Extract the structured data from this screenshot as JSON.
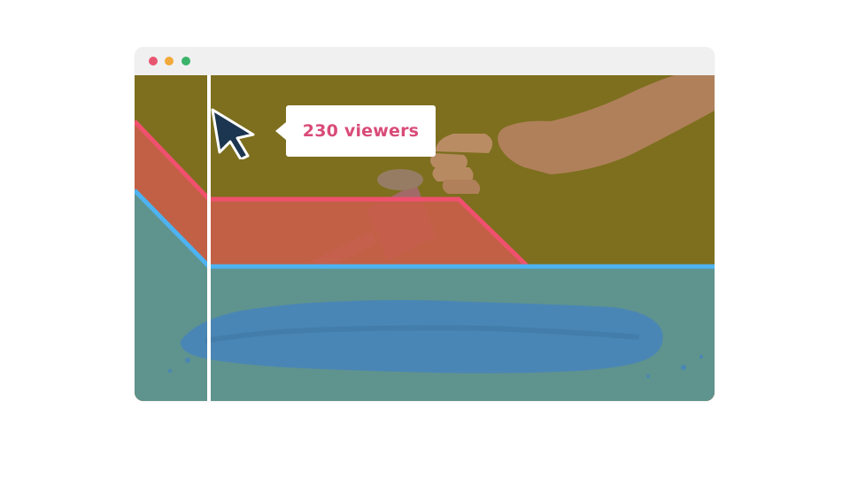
{
  "window": {
    "controls": [
      {
        "name": "close",
        "color": "#e8566f"
      },
      {
        "name": "minimize",
        "color": "#f2a93b"
      },
      {
        "name": "maximize",
        "color": "#3bb36a"
      }
    ]
  },
  "overlay": {
    "colors": {
      "top_region": "#7d6f1e",
      "middle_region": "#c85e4a",
      "bottom_region": "#5f938e",
      "red_line": "#f0506e",
      "blue_line": "#4db3f2",
      "soil": "#4a86b5",
      "playhead": "#ffffff"
    }
  },
  "tooltip": {
    "text": "230 viewers"
  },
  "cursor": {
    "icon": "pointer-arrow-icon",
    "fill": "#1c3550"
  }
}
